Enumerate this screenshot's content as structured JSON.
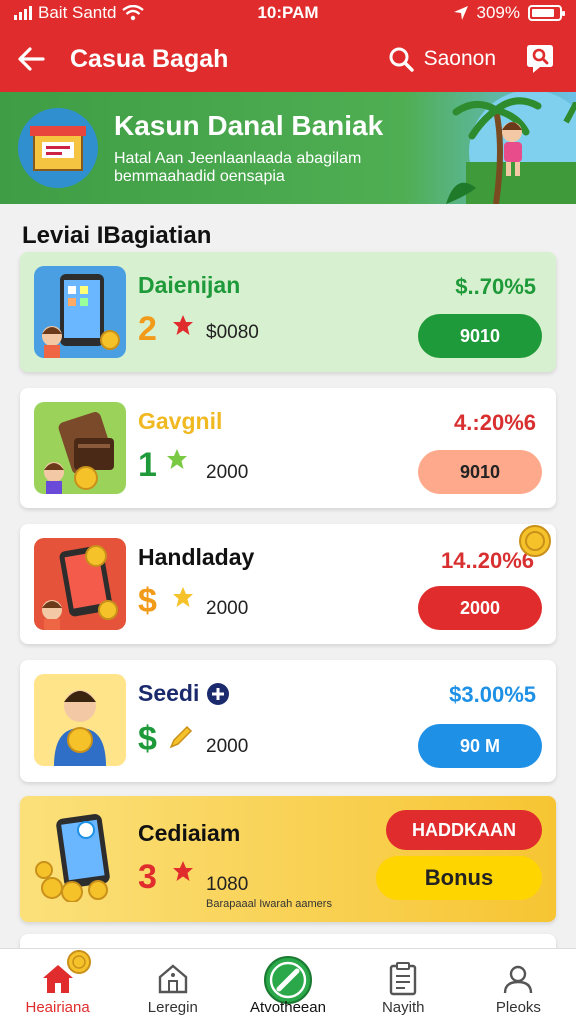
{
  "status_bar": {
    "carrier": "Bait Santd",
    "time": "10:PAM",
    "battery": "309%",
    "battery_level": 0.85
  },
  "app_bar": {
    "title": "Casua Bagah",
    "search_label": "Saonon"
  },
  "banner": {
    "title": "Kasun Danal Baniak",
    "subtitle": "Hatal Aan Jeenlaanlaada abagilam bemmaahadid oensapia"
  },
  "section": {
    "title": "Leviai IBagiatian"
  },
  "cards": [
    {
      "name": "Daienijan",
      "rank": "2",
      "amount": "$0080",
      "rate": "$..70%5",
      "button": "9010"
    },
    {
      "name": "Gavgnil",
      "rank": "1",
      "amount": "2000",
      "rate": "4.:20%6",
      "button": "9010"
    },
    {
      "name": "Handladay",
      "rank": "$",
      "amount": "2000",
      "rate": "14..20%6",
      "button": "2000"
    },
    {
      "name": "Seedi",
      "rank": "$",
      "amount": "2000",
      "rate": "$3.00%5",
      "button": "90 M"
    },
    {
      "name": "Cediaiam",
      "rank": "3",
      "amount": "1080",
      "note": "Barapaaal Iwarah aamers",
      "tag": "HADDKAAN",
      "button": "Bonus"
    }
  ],
  "nav": [
    {
      "label": "Heairiana",
      "icon": "home-icon"
    },
    {
      "label": "Leregin",
      "icon": "house-outline-icon"
    },
    {
      "label": "Atvotheean",
      "icon": "compass-icon"
    },
    {
      "label": "Nayith",
      "icon": "clipboard-icon"
    },
    {
      "label": "Pleoks",
      "icon": "profile-icon"
    }
  ],
  "colors": {
    "primary": "#e02c2c",
    "green": "#1f9a3a",
    "blue": "#1e90e6",
    "orange": "#ffa98c",
    "gold": "#f6c22a"
  }
}
